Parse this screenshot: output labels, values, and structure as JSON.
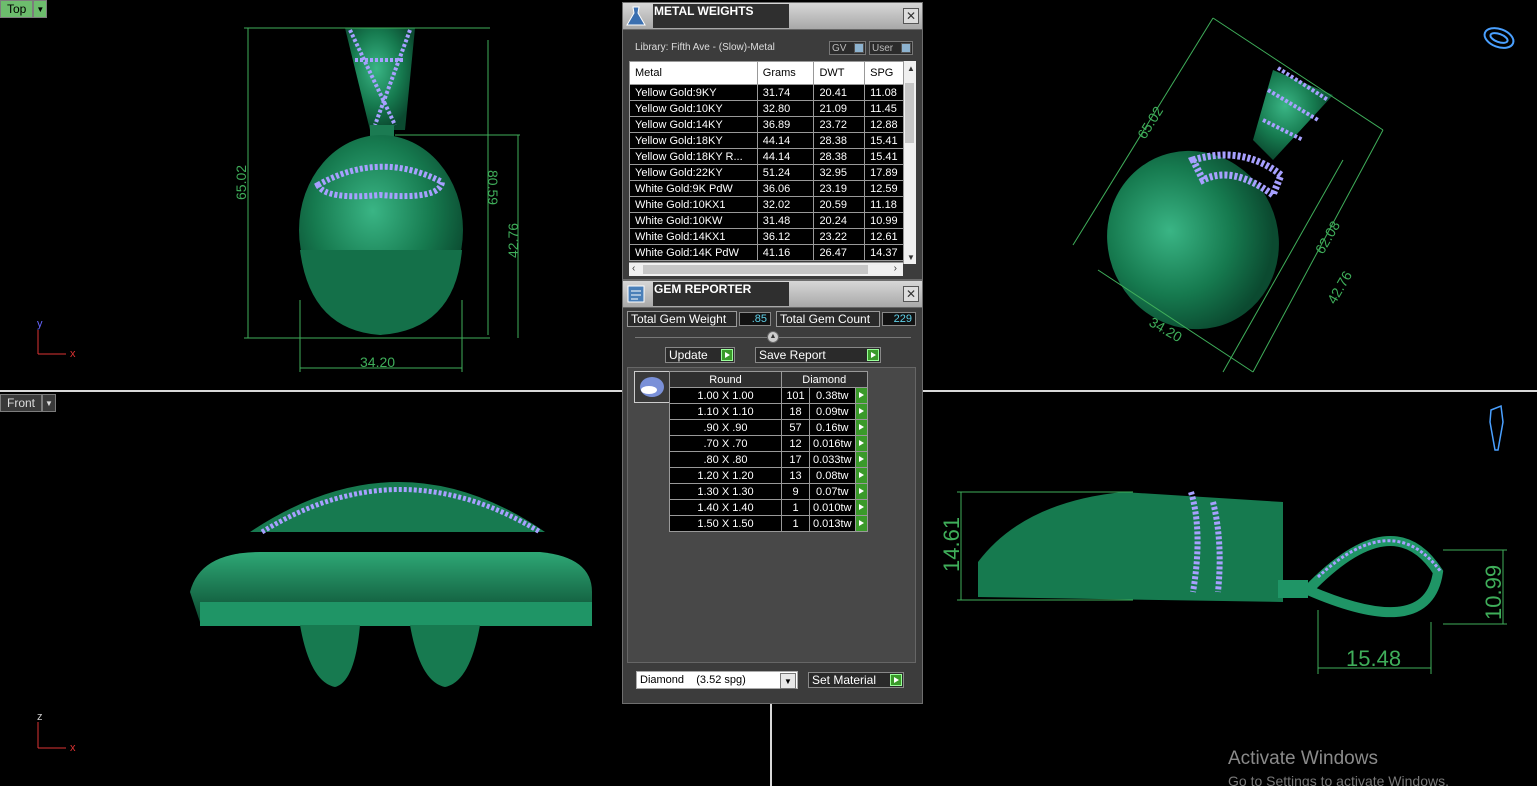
{
  "viewports": {
    "top": {
      "label": "Top",
      "axis_y": "y",
      "axis_x": "x",
      "dims": [
        "65.02",
        "80.59",
        "42.76",
        "34.20"
      ]
    },
    "perspective": {
      "dims": [
        "65.02",
        "62.08",
        "42.76",
        "34.20"
      ]
    },
    "front": {
      "label": "Front",
      "axis_y": "z",
      "axis_x": "x"
    },
    "right": {
      "axis_y": "z",
      "axis_x": "y",
      "dims": [
        "14.61",
        "10.99",
        "15.48"
      ]
    }
  },
  "metal_weights": {
    "title": "METAL WEIGHTS",
    "library": "Library: Fifth Ave - (Slow)-Metal",
    "gv_label": "GV",
    "user_label": "User",
    "columns": [
      "Metal",
      "Grams",
      "DWT",
      "SPG"
    ],
    "rows": [
      [
        "Yellow Gold:9KY",
        "31.74",
        "20.41",
        "11.08"
      ],
      [
        "Yellow Gold:10KY",
        "32.80",
        "21.09",
        "11.45"
      ],
      [
        "Yellow Gold:14KY",
        "36.89",
        "23.72",
        "12.88"
      ],
      [
        "Yellow Gold:18KY",
        "44.14",
        "28.38",
        "15.41"
      ],
      [
        "Yellow Gold:18KY R...",
        "44.14",
        "28.38",
        "15.41"
      ],
      [
        "Yellow Gold:22KY",
        "51.24",
        "32.95",
        "17.89"
      ],
      [
        "White Gold:9K PdW",
        "36.06",
        "23.19",
        "12.59"
      ],
      [
        "White Gold:10KX1",
        "32.02",
        "20.59",
        "11.18"
      ],
      [
        "White Gold:10KW",
        "31.48",
        "20.24",
        "10.99"
      ],
      [
        "White Gold:14KX1",
        "36.12",
        "23.22",
        "12.61"
      ],
      [
        "White Gold:14K PdW",
        "41.16",
        "26.47",
        "14.37"
      ]
    ]
  },
  "gem_reporter": {
    "title": "GEM REPORTER",
    "total_weight_label": "Total Gem Weight",
    "total_weight_value": ".85",
    "total_count_label": "Total Gem Count",
    "total_count_value": "229",
    "update_label": "Update",
    "save_report_label": "Save Report",
    "col_shape": "Round",
    "col_material": "Diamond",
    "rows": [
      [
        "1.00 X 1.00",
        "101",
        "0.38tw"
      ],
      [
        "1.10 X 1.10",
        "18",
        "0.09tw"
      ],
      [
        ".90 X .90",
        "57",
        "0.16tw"
      ],
      [
        ".70 X .70",
        "12",
        "0.016tw"
      ],
      [
        ".80 X .80",
        "17",
        "0.033tw"
      ],
      [
        "1.20 X 1.20",
        "13",
        "0.08tw"
      ],
      [
        "1.30 X 1.30",
        "9",
        "0.07tw"
      ],
      [
        "1.40 X 1.40",
        "1",
        "0.010tw"
      ],
      [
        "1.50 X 1.50",
        "1",
        "0.013tw"
      ]
    ],
    "material_select": "Diamond    (3.52 spg)",
    "set_material_label": "Set Material"
  },
  "watermark": {
    "line1": "Activate Windows",
    "line2": "Go to Settings to activate Windows."
  },
  "colors": {
    "model": "#1e8a5c",
    "gems": "#a7a0ff",
    "dim_lines": "#3fae5a",
    "green_btn": "#3a9a2a"
  }
}
